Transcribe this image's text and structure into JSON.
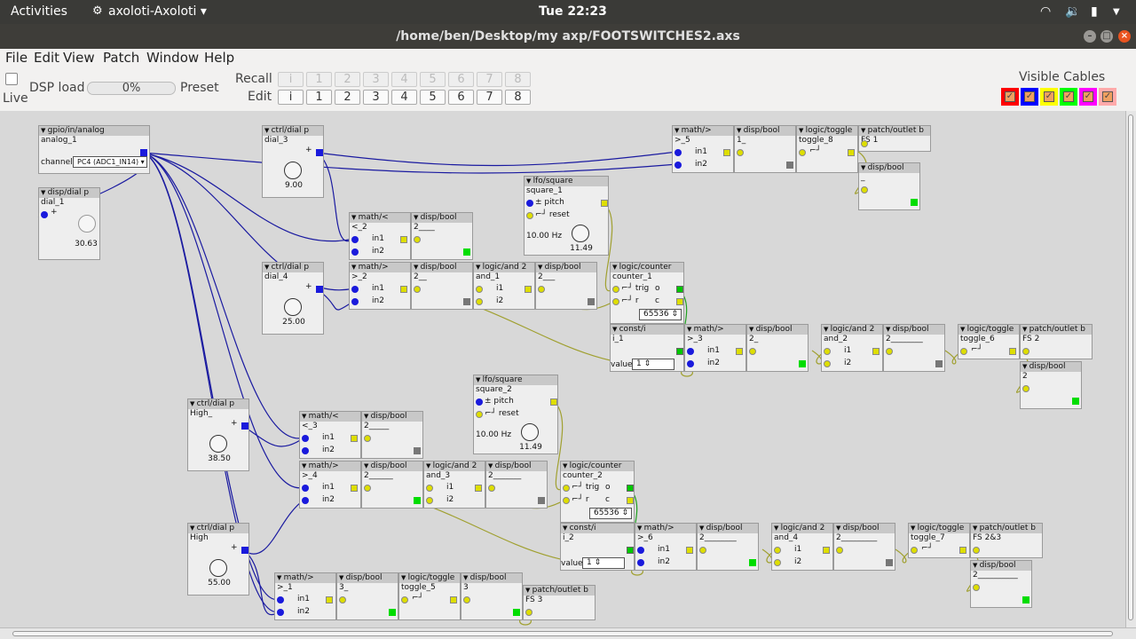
{
  "topbar": {
    "activities": "Activities",
    "app": "axoloti-Axoloti ▾",
    "clock": "Tue 22:23"
  },
  "window": {
    "title": "/home/ben/Desktop/my axp/FOOTSWITCHES2.axs"
  },
  "menu": [
    "File",
    "Edit",
    "View",
    "Patch",
    "Window",
    "Help"
  ],
  "toolbar": {
    "live": "Live",
    "dspload": "DSP load",
    "dsp_value": "0%",
    "preset": "Preset",
    "recall": "Recall",
    "edit": "Edit",
    "preset_buttons": [
      "i",
      "1",
      "2",
      "3",
      "4",
      "5",
      "6",
      "7",
      "8"
    ],
    "visible_cables": "Visible Cables"
  },
  "cable_colors": [
    "#ff0000",
    "#0000ff",
    "#ffff00",
    "#00ff00",
    "#ff00ff",
    "#ffaaaa"
  ],
  "objects": [
    {
      "id": "gpio",
      "type": "gpio/in/analog",
      "name": "analog_1",
      "channel_label": "channel",
      "channel": "PC4 (ADC1_IN14)"
    },
    {
      "id": "dial1",
      "type": "disp/dial p",
      "name": "dial_1",
      "value": "30.63"
    },
    {
      "id": "dial3",
      "type": "ctrl/dial p",
      "name": "dial_3",
      "value": "9.00"
    },
    {
      "id": "dial4",
      "type": "ctrl/dial p",
      "name": "dial_4",
      "value": "25.00"
    },
    {
      "id": "high_",
      "type": "ctrl/dial p",
      "name": "High_",
      "value": "38.50"
    },
    {
      "id": "high",
      "type": "ctrl/dial p",
      "name": "High",
      "value": "55.00"
    },
    {
      "id": "gt5",
      "type": "math/>",
      "name": ">_5"
    },
    {
      "id": "db1_",
      "type": "disp/bool",
      "name": "1_"
    },
    {
      "id": "tog8",
      "type": "logic/toggle",
      "name": "toggle_8"
    },
    {
      "id": "out_fs1",
      "type": "patch/outlet b",
      "name": "FS 1"
    },
    {
      "id": "db_fs1",
      "type": "disp/bool",
      "name": "_"
    },
    {
      "id": "sq1",
      "type": "lfo/square",
      "name": "square_1",
      "freq": "10.00 Hz",
      "knob": "11.49"
    },
    {
      "id": "lt2",
      "type": "math/<",
      "name": "<_2"
    },
    {
      "id": "db2a",
      "type": "disp/bool",
      "name": "2____"
    },
    {
      "id": "gt2",
      "type": "math/>",
      "name": ">_2"
    },
    {
      "id": "db2b",
      "type": "disp/bool",
      "name": "2__"
    },
    {
      "id": "and1",
      "type": "logic/and 2",
      "name": "and_1"
    },
    {
      "id": "db2c",
      "type": "disp/bool",
      "name": "2___"
    },
    {
      "id": "cnt1",
      "type": "logic/counter",
      "name": "counter_1",
      "max": "65536"
    },
    {
      "id": "consti1",
      "type": "const/i",
      "name": "i_1",
      "value": "1"
    },
    {
      "id": "gt3",
      "type": "math/>",
      "name": ">_3"
    },
    {
      "id": "db2d",
      "type": "disp/bool",
      "name": "2_"
    },
    {
      "id": "and2",
      "type": "logic/and 2",
      "name": "and_2"
    },
    {
      "id": "db2e",
      "type": "disp/bool",
      "name": "2________"
    },
    {
      "id": "tog6",
      "type": "logic/toggle",
      "name": "toggle_6"
    },
    {
      "id": "out_fs2",
      "type": "patch/outlet b",
      "name": "FS 2"
    },
    {
      "id": "db_fs2",
      "type": "disp/bool",
      "name": "2"
    },
    {
      "id": "sq2",
      "type": "lfo/square",
      "name": "square_2",
      "freq": "10.00 Hz",
      "knob": "11.49"
    },
    {
      "id": "lt3",
      "type": "math/<",
      "name": "<_3"
    },
    {
      "id": "db3a",
      "type": "disp/bool",
      "name": "2_____"
    },
    {
      "id": "gt4",
      "type": "math/>",
      "name": ">_4"
    },
    {
      "id": "db3b",
      "type": "disp/bool",
      "name": "2______"
    },
    {
      "id": "and3",
      "type": "logic/and 2",
      "name": "and_3"
    },
    {
      "id": "db3c",
      "type": "disp/bool",
      "name": "2_______"
    },
    {
      "id": "cnt2",
      "type": "logic/counter",
      "name": "counter_2",
      "max": "65536"
    },
    {
      "id": "consti2",
      "type": "const/i",
      "name": "i_2",
      "value": "1"
    },
    {
      "id": "gt6",
      "type": "math/>",
      "name": ">_6"
    },
    {
      "id": "db3d",
      "type": "disp/bool",
      "name": "2________"
    },
    {
      "id": "and4",
      "type": "logic/and 2",
      "name": "and_4"
    },
    {
      "id": "db3e",
      "type": "disp/bool",
      "name": "2_________"
    },
    {
      "id": "tog7",
      "type": "logic/toggle",
      "name": "toggle_7"
    },
    {
      "id": "out_fs23",
      "type": "patch/outlet b",
      "name": "FS 2&3"
    },
    {
      "id": "db_fs23",
      "type": "disp/bool",
      "name": "2__________"
    },
    {
      "id": "gt1",
      "type": "math/>",
      "name": ">_1"
    },
    {
      "id": "db3f",
      "type": "disp/bool",
      "name": "3_"
    },
    {
      "id": "tog5",
      "type": "logic/toggle",
      "name": "toggle_5"
    },
    {
      "id": "db3g",
      "type": "disp/bool",
      "name": "3"
    },
    {
      "id": "out_fs3",
      "type": "patch/outlet b",
      "name": "FS 3"
    }
  ],
  "ports": {
    "in1": "in1",
    "in2": "in2",
    "i1": "i1",
    "i2": "i2",
    "pitch": "pitch",
    "reset": "reset",
    "trig": "trig",
    "r": "r",
    "o": "o",
    "c": "c",
    "value": "value"
  }
}
